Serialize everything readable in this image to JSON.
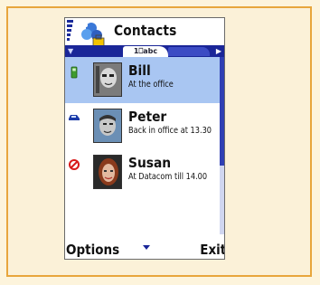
{
  "app": {
    "title": "Contacts"
  },
  "tabs": {
    "active_label": "1&#9719;abc"
  },
  "contacts": [
    {
      "name": "Bill",
      "status": "At the office",
      "status_icon": "phone-green-icon",
      "selected": true
    },
    {
      "name": "Peter",
      "status": "Back in office at 13.30",
      "status_icon": "car-icon",
      "selected": false
    },
    {
      "name": "Susan",
      "status": "At Datacom till 14.00",
      "status_icon": "do-not-disturb-icon",
      "selected": false
    }
  ],
  "softkeys": {
    "left": "Options",
    "right": "Exit"
  },
  "colors": {
    "accent": "#1a2698",
    "selection": "#a9c6f2",
    "frame": "#e8a63c"
  }
}
